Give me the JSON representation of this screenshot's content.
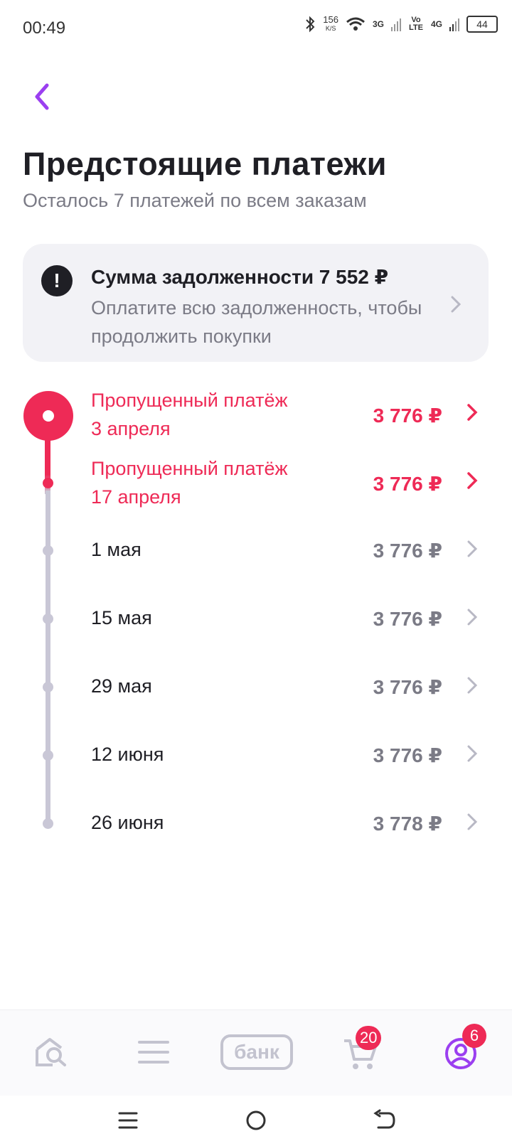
{
  "status_bar": {
    "time": "00:49",
    "speed": "156",
    "speed_unit": "K/S",
    "net1": "3G",
    "volte": "Vo LTE",
    "net2": "4G",
    "battery": "44"
  },
  "header": {
    "title": "Предстоящие платежи",
    "subtitle": "Осталось 7 платежей по всем заказам"
  },
  "debt_card": {
    "title": "Сумма задолженности 7 552 ₽",
    "text": "Оплатите всю задолженность, чтобы продолжить покупки",
    "alert_symbol": "!"
  },
  "payments": [
    {
      "title": "Пропущенный платёж",
      "date": "3 апреля",
      "amount": "3 776 ₽",
      "status": "missed"
    },
    {
      "title": "Пропущенный платёж",
      "date": "17 апреля",
      "amount": "3 776 ₽",
      "status": "missed"
    },
    {
      "date": "1 мая",
      "amount": "3 776 ₽",
      "status": "upcoming"
    },
    {
      "date": "15 мая",
      "amount": "3 776 ₽",
      "status": "upcoming"
    },
    {
      "date": "29 мая",
      "amount": "3 776 ₽",
      "status": "upcoming"
    },
    {
      "date": "12 июня",
      "amount": "3 776 ₽",
      "status": "upcoming"
    },
    {
      "date": "26 июня",
      "amount": "3 778 ₽",
      "status": "upcoming"
    }
  ],
  "bottom_nav": {
    "items": [
      {
        "name": "home-search",
        "icon": "home-search-icon"
      },
      {
        "name": "catalog",
        "icon": "menu-icon"
      },
      {
        "name": "bank",
        "label": "банк"
      },
      {
        "name": "cart",
        "icon": "cart-icon",
        "badge": "20"
      },
      {
        "name": "profile",
        "icon": "profile-icon",
        "badge": "6"
      }
    ]
  },
  "colors": {
    "accent": "#ee2a56",
    "brand": "#9b3ff0",
    "muted": "#7b7b86",
    "line": "#c9c7d6"
  }
}
